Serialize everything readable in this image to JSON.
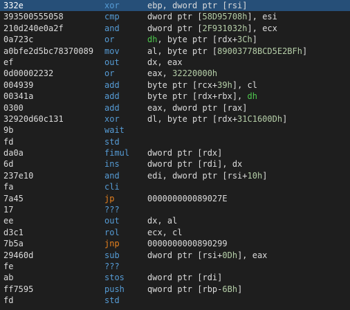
{
  "colors": {
    "background": "#1e1e1e",
    "selection": "#264f78",
    "text": "#dcdcdc",
    "mnemonic": "#569cd6",
    "jump_mnemonic": "#e8821e",
    "number": "#b5cea8",
    "register_highlight": "#4ec94e"
  },
  "rows": [
    {
      "bytes": "332e",
      "mnemonic": "xor",
      "kind": "normal",
      "selected": true,
      "operands": [
        {
          "t": "ebp, dword ptr [rsi]",
          "c": "reg"
        }
      ]
    },
    {
      "bytes": "393500555058",
      "mnemonic": "cmp",
      "kind": "normal",
      "operands": [
        {
          "t": "dword ptr [",
          "c": "reg"
        },
        {
          "t": "58D95708h",
          "c": "num"
        },
        {
          "t": "], esi",
          "c": "reg"
        }
      ]
    },
    {
      "bytes": "210d240e0a2f",
      "mnemonic": "and",
      "kind": "normal",
      "operands": [
        {
          "t": "dword ptr [",
          "c": "reg"
        },
        {
          "t": "2F931032h",
          "c": "num"
        },
        {
          "t": "], ecx",
          "c": "reg"
        }
      ]
    },
    {
      "bytes": "0a723c",
      "mnemonic": "or",
      "kind": "normal",
      "operands": [
        {
          "t": "dh",
          "c": "hi"
        },
        {
          "t": ", byte ptr [rdx+",
          "c": "reg"
        },
        {
          "t": "3Ch",
          "c": "num"
        },
        {
          "t": "]",
          "c": "reg"
        }
      ]
    },
    {
      "bytes": "a0bfe2d5bc78370089",
      "mnemonic": "mov",
      "kind": "normal",
      "operands": [
        {
          "t": "al, byte ptr [",
          "c": "reg"
        },
        {
          "t": "89003778BCD5E2BFh",
          "c": "num"
        },
        {
          "t": "]",
          "c": "reg"
        }
      ]
    },
    {
      "bytes": "ef",
      "mnemonic": "out",
      "kind": "normal",
      "operands": [
        {
          "t": "dx, eax",
          "c": "reg"
        }
      ]
    },
    {
      "bytes": "0d00002232",
      "mnemonic": "or",
      "kind": "normal",
      "operands": [
        {
          "t": "eax, ",
          "c": "reg"
        },
        {
          "t": "32220000h",
          "c": "num"
        }
      ]
    },
    {
      "bytes": "004939",
      "mnemonic": "add",
      "kind": "normal",
      "operands": [
        {
          "t": "byte ptr [rcx+",
          "c": "reg"
        },
        {
          "t": "39h",
          "c": "num"
        },
        {
          "t": "], cl",
          "c": "reg"
        }
      ]
    },
    {
      "bytes": "00341a",
      "mnemonic": "add",
      "kind": "normal",
      "operands": [
        {
          "t": "byte ptr [rdx+rbx], ",
          "c": "reg"
        },
        {
          "t": "dh",
          "c": "hi"
        }
      ]
    },
    {
      "bytes": "0300",
      "mnemonic": "add",
      "kind": "normal",
      "operands": [
        {
          "t": "eax, dword ptr [rax]",
          "c": "reg"
        }
      ]
    },
    {
      "bytes": "32920d60c131",
      "mnemonic": "xor",
      "kind": "normal",
      "operands": [
        {
          "t": "dl, byte ptr [rdx+",
          "c": "reg"
        },
        {
          "t": "31C1600Dh",
          "c": "num"
        },
        {
          "t": "]",
          "c": "reg"
        }
      ]
    },
    {
      "bytes": "9b",
      "mnemonic": "wait",
      "kind": "normal",
      "operands": []
    },
    {
      "bytes": "fd",
      "mnemonic": "std",
      "kind": "normal",
      "operands": []
    },
    {
      "bytes": "da0a",
      "mnemonic": "fimul",
      "kind": "normal",
      "operands": [
        {
          "t": "dword ptr [rdx]",
          "c": "reg"
        }
      ]
    },
    {
      "bytes": "6d",
      "mnemonic": "ins",
      "kind": "normal",
      "operands": [
        {
          "t": "dword ptr [rdi], dx",
          "c": "reg"
        }
      ]
    },
    {
      "bytes": "237e10",
      "mnemonic": "and",
      "kind": "normal",
      "operands": [
        {
          "t": "edi, dword ptr [rsi+",
          "c": "reg"
        },
        {
          "t": "10h",
          "c": "num"
        },
        {
          "t": "]",
          "c": "reg"
        }
      ]
    },
    {
      "bytes": "fa",
      "mnemonic": "cli",
      "kind": "normal",
      "operands": []
    },
    {
      "bytes": "7a45",
      "mnemonic": "jp",
      "kind": "jump",
      "operands": [
        {
          "t": "000000000089027E",
          "c": "reg"
        }
      ]
    },
    {
      "bytes": "17",
      "mnemonic": "???",
      "kind": "unknown",
      "operands": []
    },
    {
      "bytes": "ee",
      "mnemonic": "out",
      "kind": "normal",
      "operands": [
        {
          "t": "dx, al",
          "c": "reg"
        }
      ]
    },
    {
      "bytes": "d3c1",
      "mnemonic": "rol",
      "kind": "normal",
      "operands": [
        {
          "t": "ecx, cl",
          "c": "reg"
        }
      ]
    },
    {
      "bytes": "7b5a",
      "mnemonic": "jnp",
      "kind": "jump",
      "operands": [
        {
          "t": "0000000000890299",
          "c": "reg"
        }
      ]
    },
    {
      "bytes": "29460d",
      "mnemonic": "sub",
      "kind": "normal",
      "operands": [
        {
          "t": "dword ptr [rsi+",
          "c": "reg"
        },
        {
          "t": "0Dh",
          "c": "num"
        },
        {
          "t": "], eax",
          "c": "reg"
        }
      ]
    },
    {
      "bytes": "fe",
      "mnemonic": "???",
      "kind": "unknown",
      "operands": []
    },
    {
      "bytes": "ab",
      "mnemonic": "stos",
      "kind": "normal",
      "operands": [
        {
          "t": "dword ptr [rdi]",
          "c": "reg"
        }
      ]
    },
    {
      "bytes": "ff7595",
      "mnemonic": "push",
      "kind": "normal",
      "operands": [
        {
          "t": "qword ptr [rbp-",
          "c": "reg"
        },
        {
          "t": "6Bh",
          "c": "num"
        },
        {
          "t": "]",
          "c": "reg"
        }
      ]
    },
    {
      "bytes": "fd",
      "mnemonic": "std",
      "kind": "normal",
      "operands": []
    }
  ]
}
